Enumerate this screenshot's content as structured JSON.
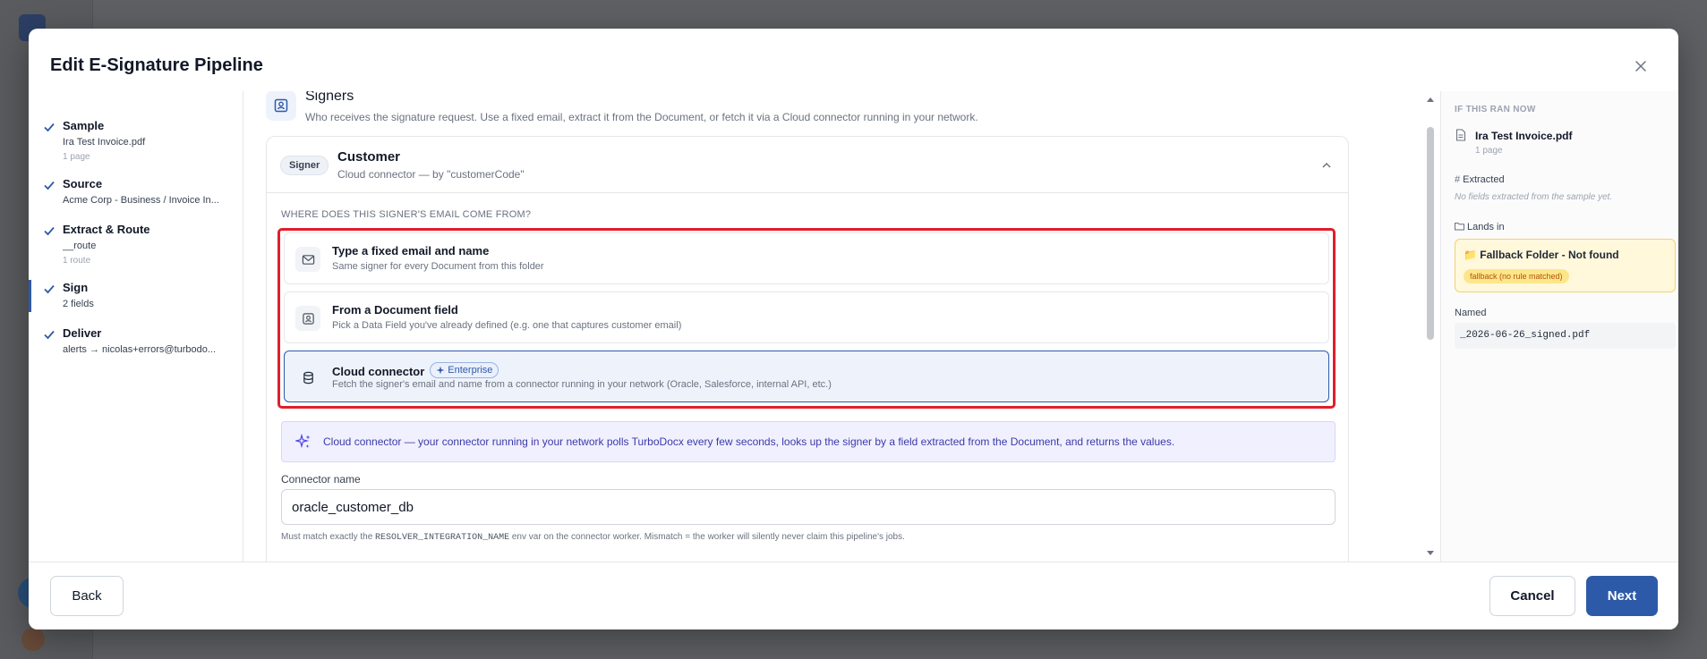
{
  "modal": {
    "title": "Edit E-Signature Pipeline"
  },
  "steps": [
    {
      "title": "Sample",
      "sub": "Ira Test Invoice.pdf",
      "meta": "1 page"
    },
    {
      "title": "Source",
      "sub": "Acme Corp - Business / Invoice In...",
      "meta": ""
    },
    {
      "title": "Extract & Route",
      "sub": "__route",
      "meta": "1 route"
    },
    {
      "title": "Sign",
      "sub": "2 fields",
      "meta": ""
    },
    {
      "title": "Deliver",
      "sub": "alerts → nicolas+errors@turbodo...",
      "meta": ""
    }
  ],
  "section": {
    "title": "Signers",
    "description": "Who receives the signature request. Use a fixed email, extract it from the Document, or fetch it via a Cloud connector running in your network."
  },
  "signer": {
    "badge": "Signer",
    "name": "Customer",
    "description": "Cloud connector — by \"customerCode\"",
    "source_question": "WHERE DOES THIS SIGNER'S EMAIL COME FROM?",
    "options": [
      {
        "title": "Type a fixed email and name",
        "desc": "Same signer for every Document from this folder"
      },
      {
        "title": "From a Document field",
        "desc": "Pick a Data Field you've already defined (e.g. one that captures customer email)"
      },
      {
        "title": "Cloud connector",
        "desc": "Fetch the signer's email and name from a connector running in your network (Oracle, Salesforce, internal API, etc.)",
        "badge": "Enterprise"
      }
    ],
    "info": "Cloud connector — your connector running in your network polls TurboDocx every few seconds, looks up the signer by a field extracted from the Document, and returns the values.",
    "connector_label": "Connector name",
    "connector_value": "oracle_customer_db",
    "connector_help_pre": "Must match exactly the ",
    "connector_help_code": "RESOLVER_INTEGRATION_NAME",
    "connector_help_post": " env var on the connector worker. Mismatch = the worker will silently never claim this pipeline's jobs."
  },
  "preview": {
    "heading": "IF THIS RAN NOW",
    "file": "Ira Test Invoice.pdf",
    "pages": "1 page",
    "extracted_label": "Extracted",
    "extracted_empty": "No fields extracted from the sample yet.",
    "lands_label": "Lands in",
    "folder_name": "📁 Fallback Folder - Not found",
    "folder_badge": "fallback (no rule matched)",
    "named_label": "Named",
    "named_value": "_2026-06-26_signed.pdf"
  },
  "footer": {
    "back": "Back",
    "cancel": "Cancel",
    "next": "Next"
  },
  "colors": {
    "accent": "#2d5aa8",
    "highlight": "#e01e2b",
    "warning_bg": "#fff8db"
  }
}
